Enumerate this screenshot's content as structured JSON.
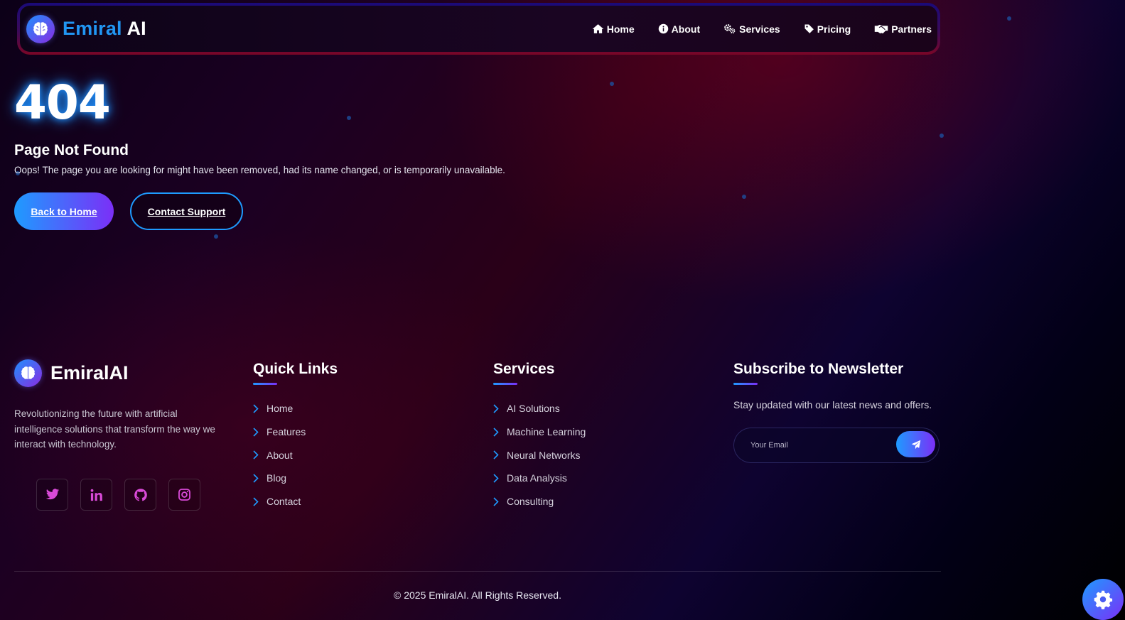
{
  "colors": {
    "accent_blue": "#1e9bff",
    "accent_purple": "#7b2ff7",
    "brand_blue": "#2196f3"
  },
  "header": {
    "logo_icon": "brain-icon",
    "logo_part1": "Emiral",
    "logo_part2": "AI",
    "nav": [
      {
        "label": "Home",
        "icon": "home-icon"
      },
      {
        "label": "About",
        "icon": "info-icon"
      },
      {
        "label": "Services",
        "icon": "gears-icon"
      },
      {
        "label": "Pricing",
        "icon": "tag-icon"
      },
      {
        "label": "Partners",
        "icon": "handshake-icon"
      }
    ]
  },
  "error": {
    "code": "404",
    "title": "Page Not Found",
    "message": "Oops! The page you are looking for might have been removed, had its name changed, or is temporarily unavailable.",
    "primary_button": "Back to Home",
    "secondary_button": "Contact Support"
  },
  "footer": {
    "brand_name": "EmiralAI",
    "description": "Revolutionizing the future with artificial intelligence solutions that transform the way we interact with technology.",
    "socials": [
      "twitter-icon",
      "linkedin-icon",
      "github-icon",
      "instagram-icon"
    ],
    "quick_links": {
      "title": "Quick Links",
      "items": [
        "Home",
        "Features",
        "About",
        "Blog",
        "Contact"
      ]
    },
    "services": {
      "title": "Services",
      "items": [
        "AI Solutions",
        "Machine Learning",
        "Neural Networks",
        "Data Analysis",
        "Consulting"
      ]
    },
    "newsletter": {
      "title": "Subscribe to Newsletter",
      "text": "Stay updated with our latest news and offers.",
      "placeholder": "Your Email",
      "button_icon": "paper-plane-icon"
    },
    "copyright": "© 2025 EmiralAI. All Rights Reserved."
  },
  "settings_button_icon": "gear-icon"
}
